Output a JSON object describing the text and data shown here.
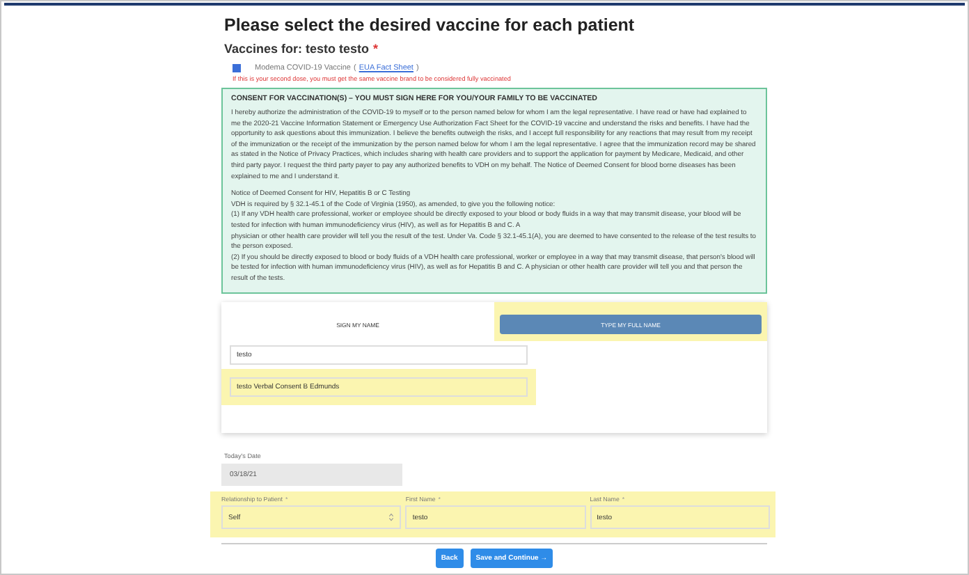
{
  "page_title": "Please select the desired vaccine for each patient",
  "patient_heading": {
    "label": "Vaccines for: testo testo",
    "required_mark": "*"
  },
  "vaccine": {
    "name": "Modema COVID-19 Vaccine",
    "link_open": "(",
    "link": "EUA Fact Sheet",
    "link_close": ")",
    "checked": true,
    "warning": "If this is your second dose, you must get the same vaccine brand to be considered fully vaccinated"
  },
  "consent": {
    "title": "CONSENT FOR VACCINATION(S) – YOU MUST SIGN HERE FOR YOU/YOUR FAMILY TO BE VACCINATED",
    "paragraphs": [
      [
        "I hereby authorize the administration of the COVID-19 to myself or to the person named below for whom I am the legal representative. I have read or have had explained to me the 2020-21 Vaccine Information Statement or Emergency Use Authorization Fact Sheet for the COVID-19 vaccine and understand the risks and benefits. I have had the opportunity to ask questions about this immunization. I believe the benefits outweigh the risks, and I accept full responsibility for any reactions that may result from my receipt of the immunization or the receipt of the immunization by the person named below for whom I am the legal representative. I agree that the immunization record may be shared as stated in the Notice of Privacy Practices, which includes sharing with health care providers and to support the application for payment by Medicare, Medicaid, and other third party payor. I request the third party payer to pay any authorized benefits to VDH on my behalf. The Notice of Deemed Consent for blood borne diseases has been explained to me and I understand it."
      ],
      [
        "Notice of Deemed Consent for HIV, Hepatitis B or C Testing",
        "VDH is required by § 32.1-45.1 of the Code of Virginia (1950), as amended, to give you the following notice:",
        "(1) If any VDH health care professional, worker or employee should be directly exposed to your blood or body fluids in a way that may transmit disease, your blood will be tested for infection with human immunodeficiency virus (HIV), as well as for Hepatitis B and C. A",
        "physician or other health care provider will tell you the result of the test. Under Va. Code § 32.1-45.1(A), you are deemed to have consented to the release of the test results to the person exposed.",
        "(2) If you should be directly exposed to blood or body fluids of a VDH health care professional, worker or employee in a way that may transmit disease, that person's blood will be tested for infection with human immunodeficiency virus (HIV), as well as for Hepatitis B and C. A physician or other health care provider will tell you and that person the result of the tests."
      ]
    ]
  },
  "signature_tabs": [
    {
      "label": "SIGN MY NAME",
      "selected": false
    },
    {
      "label": "TYPE MY FULL NAME",
      "selected": true
    }
  ],
  "signature_fields": [
    {
      "value": "testo"
    },
    {
      "value": "testo Verbal Consent B Edmunds"
    }
  ],
  "date": {
    "label": "Today's Date",
    "value": "03/18/21"
  },
  "relation_fields": [
    {
      "kind": "select",
      "label": "Relationship to Patient",
      "required_mark": "*",
      "value": "Self"
    },
    {
      "kind": "text",
      "label": "First Name",
      "required_mark": "*",
      "value": "testo"
    },
    {
      "kind": "text",
      "label": "Last Name",
      "required_mark": "*",
      "value": "testo"
    }
  ],
  "buttons": [
    {
      "label": "Back"
    },
    {
      "label": "Save and Continue",
      "arrow": "→"
    }
  ]
}
